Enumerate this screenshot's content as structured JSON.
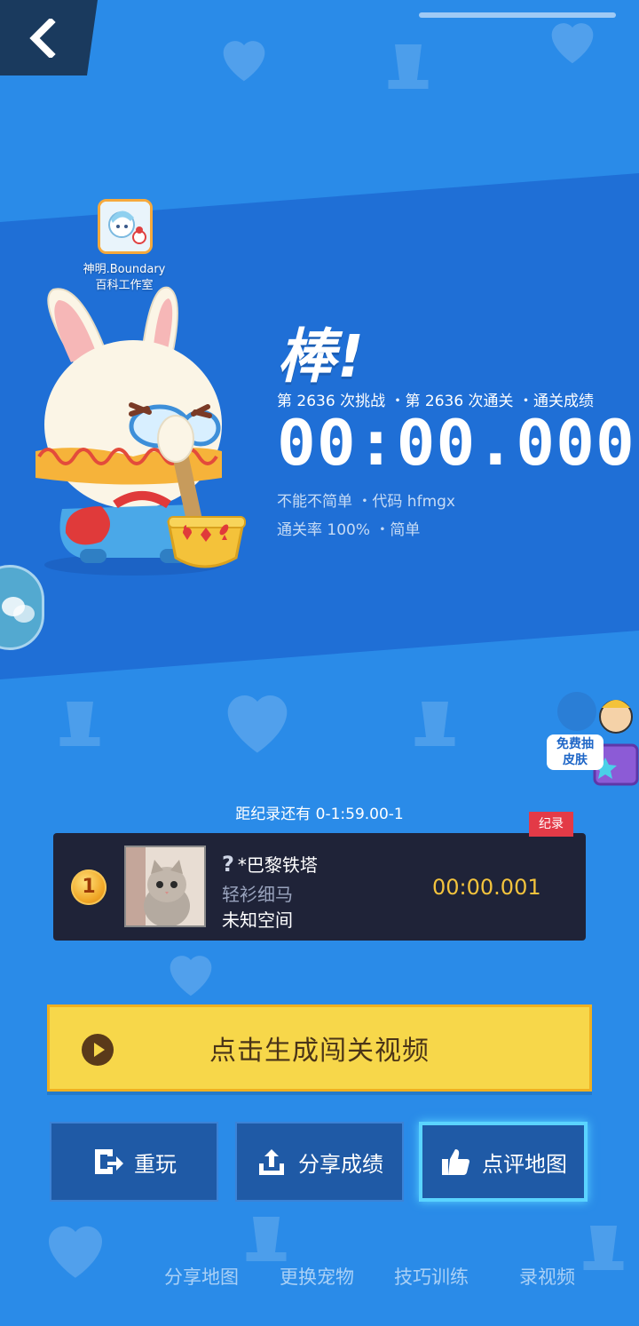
{
  "studio": {
    "line1": "神明.Boundary",
    "line2": "百科工作室"
  },
  "result": {
    "headline": "棒!",
    "stats": "第 2636 次挑战 ・第 2636 次通关 ・通关成绩",
    "time": "00:00.000",
    "meta1": "不能不简单 ・代码 hfmgx",
    "meta2": "通关率 100% ・简单"
  },
  "free_skin": {
    "line1": "免费抽",
    "line2": "皮肤"
  },
  "record": {
    "note": "距纪录还有 0-1:59.00-1",
    "tag": "纪录",
    "rank": "1",
    "player_name": "*巴黎铁塔",
    "player_title": "轻衫细马",
    "player_zone": "未知空间",
    "player_time": "00:00.001"
  },
  "buttons": {
    "generate_video": "点击生成闯关视频",
    "replay": "重玩",
    "share_score": "分享成绩",
    "review_map": "点评地图"
  },
  "bottom_links": [
    "分享地图",
    "更换宠物",
    "技巧训练",
    "录视频"
  ],
  "colors": {
    "background": "#2a8be8",
    "band": "#1f6fd6",
    "record_time": "#f3c33d",
    "video_button": "#f7d74a"
  }
}
